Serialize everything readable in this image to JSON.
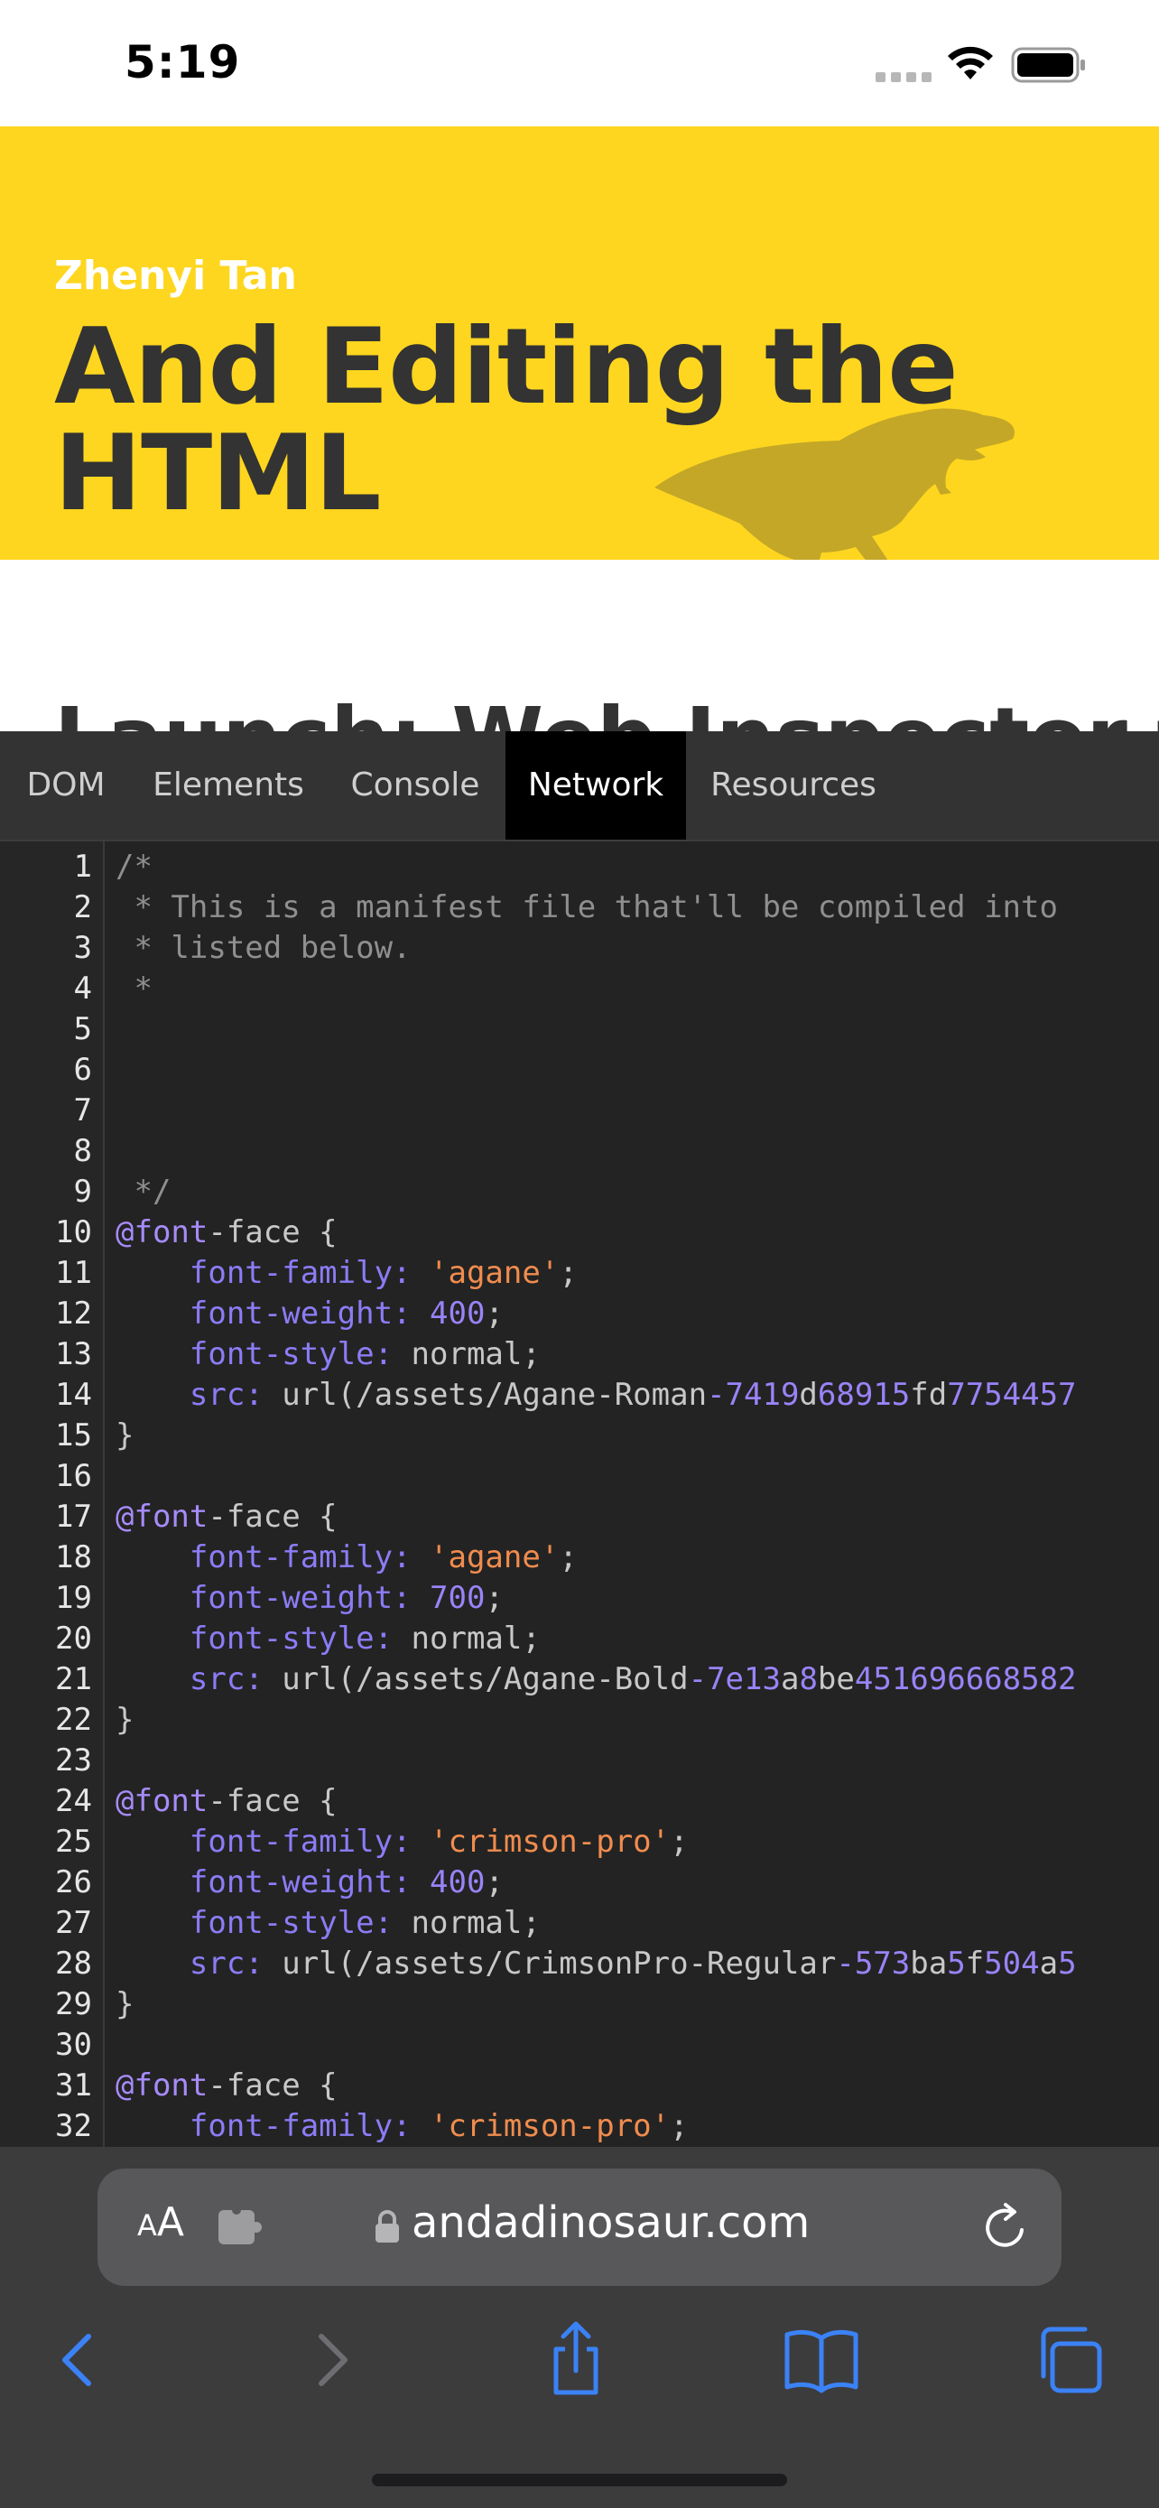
{
  "status": {
    "time": "5:19"
  },
  "banner": {
    "author": "Zhenyi Tan",
    "title": "And Editing the HTML",
    "partial_heading": "Launch: Web Inspector for"
  },
  "tabs": [
    {
      "label": "DOM",
      "active": false
    },
    {
      "label": "Elements",
      "active": false
    },
    {
      "label": "Console",
      "active": false
    },
    {
      "label": "Network",
      "active": true
    },
    {
      "label": "Resources",
      "active": false
    }
  ],
  "code_lines": [
    {
      "num": "1",
      "parts": [
        [
          "c",
          "/*"
        ]
      ]
    },
    {
      "num": "2",
      "parts": [
        [
          "c",
          " * This is a manifest file that'll be compiled into"
        ]
      ]
    },
    {
      "num": "3",
      "parts": [
        [
          "c",
          " * listed below."
        ]
      ]
    },
    {
      "num": "4",
      "parts": [
        [
          "c",
          " *"
        ]
      ]
    },
    {
      "num": "5",
      "parts": []
    },
    {
      "num": "6",
      "parts": []
    },
    {
      "num": "7",
      "parts": []
    },
    {
      "num": "8",
      "parts": []
    },
    {
      "num": "9",
      "parts": [
        [
          "c",
          " */"
        ]
      ]
    },
    {
      "num": "10",
      "parts": [
        [
          "at",
          "@font"
        ],
        [
          "d",
          "-face {"
        ]
      ]
    },
    {
      "num": "11",
      "parts": [
        [
          "d",
          "    "
        ],
        [
          "p",
          "font-family:"
        ],
        [
          "d",
          " "
        ],
        [
          "s",
          "'agane'"
        ],
        [
          "d",
          ";"
        ]
      ]
    },
    {
      "num": "12",
      "parts": [
        [
          "d",
          "    "
        ],
        [
          "p",
          "font-weight:"
        ],
        [
          "d",
          " "
        ],
        [
          "n",
          "400"
        ],
        [
          "d",
          ";"
        ]
      ]
    },
    {
      "num": "13",
      "parts": [
        [
          "d",
          "    "
        ],
        [
          "p",
          "font-style:"
        ],
        [
          "d",
          " normal;"
        ]
      ]
    },
    {
      "num": "14",
      "parts": [
        [
          "d",
          "    "
        ],
        [
          "p",
          "src:"
        ],
        [
          "d",
          " url(/assets/Agane-Roman"
        ],
        [
          "n",
          "-7419"
        ],
        [
          "d",
          "d"
        ],
        [
          "n",
          "68915"
        ],
        [
          "d",
          "fd"
        ],
        [
          "n",
          "7754457"
        ]
      ]
    },
    {
      "num": "15",
      "parts": [
        [
          "d",
          "}"
        ]
      ]
    },
    {
      "num": "16",
      "parts": []
    },
    {
      "num": "17",
      "parts": [
        [
          "at",
          "@font"
        ],
        [
          "d",
          "-face {"
        ]
      ]
    },
    {
      "num": "18",
      "parts": [
        [
          "d",
          "    "
        ],
        [
          "p",
          "font-family:"
        ],
        [
          "d",
          " "
        ],
        [
          "s",
          "'agane'"
        ],
        [
          "d",
          ";"
        ]
      ]
    },
    {
      "num": "19",
      "parts": [
        [
          "d",
          "    "
        ],
        [
          "p",
          "font-weight:"
        ],
        [
          "d",
          " "
        ],
        [
          "n",
          "700"
        ],
        [
          "d",
          ";"
        ]
      ]
    },
    {
      "num": "20",
      "parts": [
        [
          "d",
          "    "
        ],
        [
          "p",
          "font-style:"
        ],
        [
          "d",
          " normal;"
        ]
      ]
    },
    {
      "num": "21",
      "parts": [
        [
          "d",
          "    "
        ],
        [
          "p",
          "src:"
        ],
        [
          "d",
          " url(/assets/Agane-Bold"
        ],
        [
          "n",
          "-7e13"
        ],
        [
          "d",
          "a"
        ],
        [
          "n",
          "8"
        ],
        [
          "d",
          "be"
        ],
        [
          "n",
          "451696668582"
        ]
      ]
    },
    {
      "num": "22",
      "parts": [
        [
          "d",
          "}"
        ]
      ]
    },
    {
      "num": "23",
      "parts": []
    },
    {
      "num": "24",
      "parts": [
        [
          "at",
          "@font"
        ],
        [
          "d",
          "-face {"
        ]
      ]
    },
    {
      "num": "25",
      "parts": [
        [
          "d",
          "    "
        ],
        [
          "p",
          "font-family:"
        ],
        [
          "d",
          " "
        ],
        [
          "s",
          "'crimson-pro'"
        ],
        [
          "d",
          ";"
        ]
      ]
    },
    {
      "num": "26",
      "parts": [
        [
          "d",
          "    "
        ],
        [
          "p",
          "font-weight:"
        ],
        [
          "d",
          " "
        ],
        [
          "n",
          "400"
        ],
        [
          "d",
          ";"
        ]
      ]
    },
    {
      "num": "27",
      "parts": [
        [
          "d",
          "    "
        ],
        [
          "p",
          "font-style:"
        ],
        [
          "d",
          " normal;"
        ]
      ]
    },
    {
      "num": "28",
      "parts": [
        [
          "d",
          "    "
        ],
        [
          "p",
          "src:"
        ],
        [
          "d",
          " url(/assets/CrimsonPro-Regular"
        ],
        [
          "n",
          "-573"
        ],
        [
          "d",
          "ba"
        ],
        [
          "n",
          "5"
        ],
        [
          "d",
          "f"
        ],
        [
          "n",
          "504"
        ],
        [
          "d",
          "a"
        ],
        [
          "n",
          "5"
        ]
      ]
    },
    {
      "num": "29",
      "parts": [
        [
          "d",
          "}"
        ]
      ]
    },
    {
      "num": "30",
      "parts": []
    },
    {
      "num": "31",
      "parts": [
        [
          "at",
          "@font"
        ],
        [
          "d",
          "-face {"
        ]
      ]
    },
    {
      "num": "32",
      "parts": [
        [
          "d",
          "    "
        ],
        [
          "p",
          "font-family:"
        ],
        [
          "d",
          " "
        ],
        [
          "s",
          "'crimson-pro'"
        ],
        [
          "d",
          ";"
        ]
      ]
    }
  ],
  "toolbar": {
    "aa_small": "A",
    "aa_large": "A",
    "url": "andadinosaur.com"
  },
  "icons": {
    "back": "chevron-left-icon",
    "forward": "chevron-right-icon",
    "share": "share-icon",
    "bookmarks": "book-icon",
    "tabs": "tabs-icon"
  },
  "colors": {
    "banner": "#fed61f",
    "inspector_bg": "#232323",
    "accent": "#3b82f6"
  }
}
